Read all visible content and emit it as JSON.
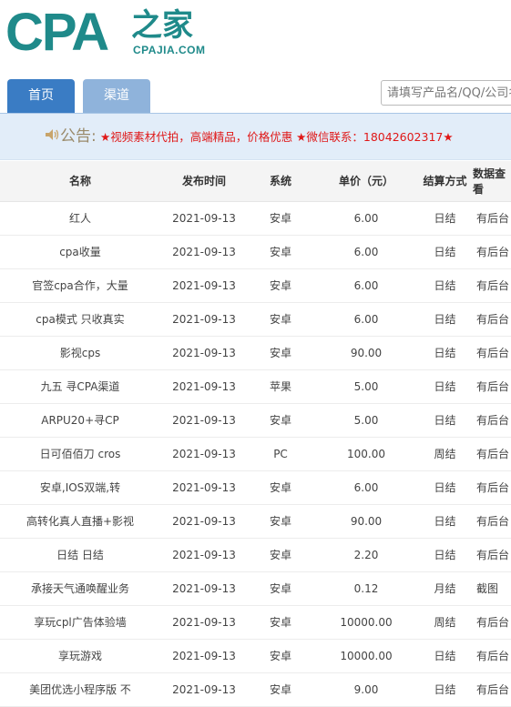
{
  "logo": {
    "cpa": "CPA",
    "cn": "之家",
    "url": "CPAJIA.COM"
  },
  "nav": {
    "home": "首页",
    "channel": "渠道"
  },
  "search": {
    "placeholder": "请填写产品名/QQ/公司名"
  },
  "notice": {
    "label": "公告:",
    "text": "★视频素材代拍，高端精品，价格优惠 ★微信联系：18042602317★",
    "icon": "speaker-icon"
  },
  "table": {
    "headers": [
      "名称",
      "发布时间",
      "系统",
      "单价（元）",
      "结算方式",
      "数据查看"
    ],
    "rows": [
      [
        "红人",
        "2021-09-13",
        "安卓",
        "6.00",
        "日结",
        "有后台"
      ],
      [
        "cpa收量",
        "2021-09-13",
        "安卓",
        "6.00",
        "日结",
        "有后台"
      ],
      [
        "官签cpa合作，大量",
        "2021-09-13",
        "安卓",
        "6.00",
        "日结",
        "有后台"
      ],
      [
        "cpa模式 只收真实",
        "2021-09-13",
        "安卓",
        "6.00",
        "日结",
        "有后台"
      ],
      [
        "影视cps",
        "2021-09-13",
        "安卓",
        "90.00",
        "日结",
        "有后台"
      ],
      [
        "九五 寻CPA渠道",
        "2021-09-13",
        "苹果",
        "5.00",
        "日结",
        "有后台"
      ],
      [
        "ARPU20+寻CP",
        "2021-09-13",
        "安卓",
        "5.00",
        "日结",
        "有后台"
      ],
      [
        "日可佰佰刀 cros",
        "2021-09-13",
        "PC",
        "100.00",
        "周结",
        "有后台"
      ],
      [
        "安卓,IOS双端,转",
        "2021-09-13",
        "安卓",
        "6.00",
        "日结",
        "有后台"
      ],
      [
        "高转化真人直播+影视",
        "2021-09-13",
        "安卓",
        "90.00",
        "日结",
        "有后台"
      ],
      [
        "日结 日结",
        "2021-09-13",
        "安卓",
        "2.20",
        "日结",
        "有后台"
      ],
      [
        "承接天气通唤醒业务",
        "2021-09-13",
        "安卓",
        "0.12",
        "月结",
        "截图"
      ],
      [
        "享玩cpl广告体验墙",
        "2021-09-13",
        "安卓",
        "10000.00",
        "周结",
        "有后台"
      ],
      [
        "享玩游戏",
        "2021-09-13",
        "安卓",
        "10000.00",
        "日结",
        "有后台"
      ],
      [
        "美团优选小程序版 不",
        "2021-09-13",
        "安卓",
        "9.00",
        "日结",
        "有后台"
      ]
    ]
  }
}
